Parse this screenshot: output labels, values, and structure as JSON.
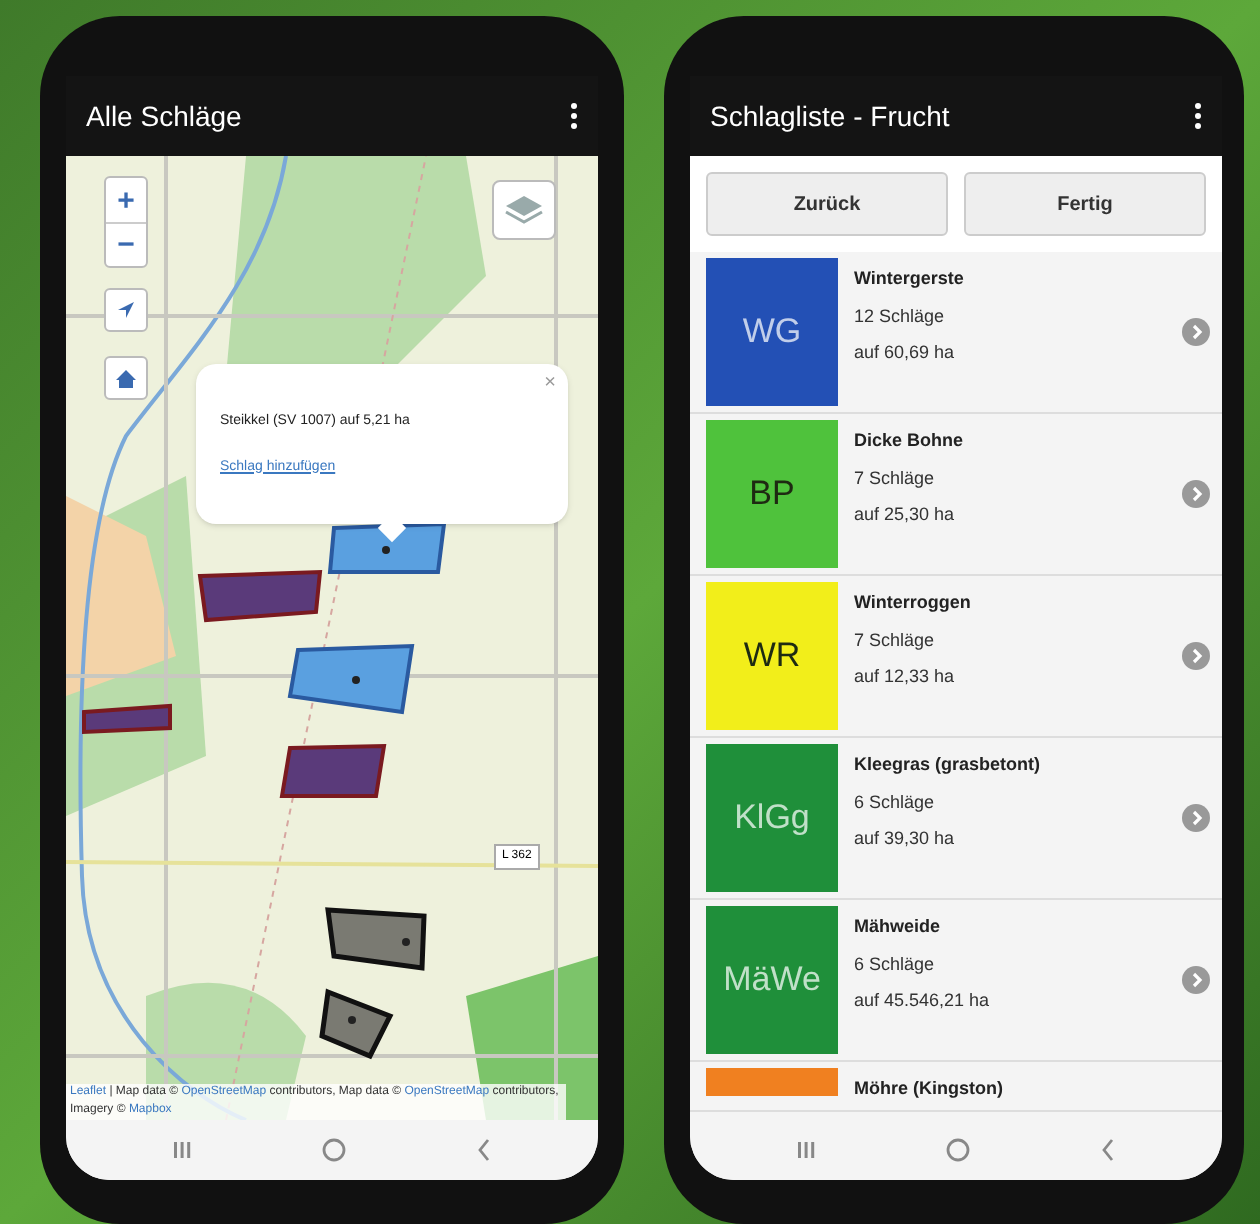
{
  "map_screen": {
    "title": "Alle Schläge",
    "zoom_in": "+",
    "zoom_out": "−",
    "road_label": "L 362",
    "popup": {
      "close": "×",
      "text": "Steikkel (SV 1007) auf 5,21 ha",
      "link": "Schlag hinzufügen"
    },
    "attribution": [
      {
        "text": "Leaflet",
        "link": true
      },
      {
        "text": "| Map data ©",
        "link": false
      },
      {
        "text": "OpenStreetMap",
        "link": true
      },
      {
        "text": "contributors, Map data ©",
        "link": false
      },
      {
        "text": "OpenStreetMap",
        "link": true
      },
      {
        "text": "contributors, Imagery ©",
        "link": false
      },
      {
        "text": "Mapbox",
        "link": true
      }
    ]
  },
  "list_screen": {
    "title": "Schlagliste - Frucht",
    "buttons": [
      "Zurück",
      "Fertig"
    ],
    "crops": [
      {
        "abbr": "WG",
        "color": "#2350b5",
        "name": "Wintergerste",
        "count": "12 Schläge",
        "area": "auf 60,69 ha"
      },
      {
        "abbr": "BP",
        "color": "#4fc23c",
        "name": "Dicke Bohne",
        "count": "7 Schläge",
        "area": "auf 25,30 ha"
      },
      {
        "abbr": "WR",
        "color": "#f2ee1a",
        "name": "Winterroggen",
        "count": "7 Schläge",
        "area": "auf 12,33 ha"
      },
      {
        "abbr": "KlGg",
        "color": "#1f8f3a",
        "name": "Kleegras (grasbetont)",
        "count": "6 Schläge",
        "area": "auf 39,30 ha"
      },
      {
        "abbr": "MäWe",
        "color": "#1f8f3a",
        "name": "Mähweide",
        "count": "6 Schläge",
        "area": "auf 45.546,21 ha"
      },
      {
        "color": "#f08020",
        "name": "Möhre (Kingston)"
      }
    ]
  }
}
